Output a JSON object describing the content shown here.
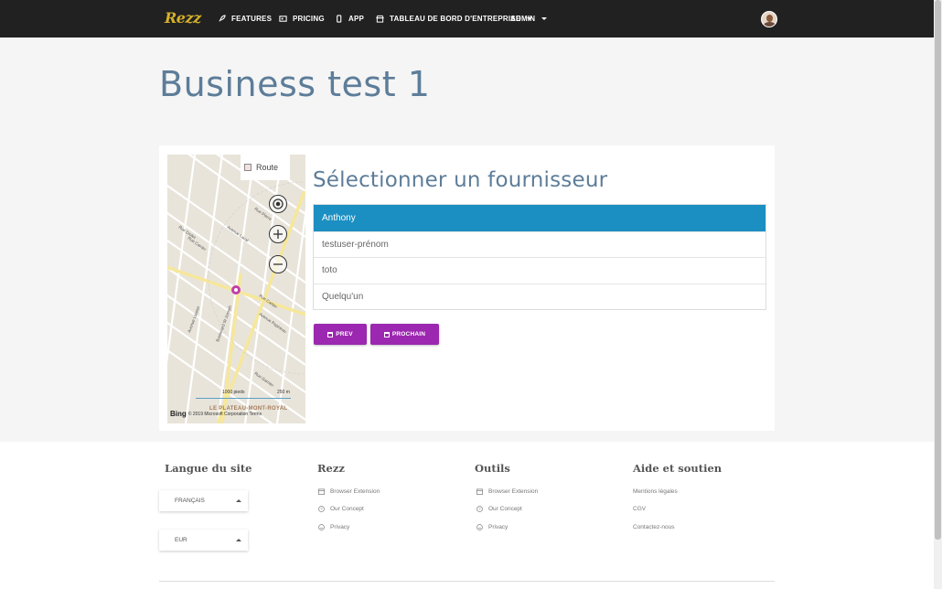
{
  "nav": {
    "logo": "Rezz",
    "items": [
      {
        "label": "FEATURES",
        "icon": "rocket-icon"
      },
      {
        "label": "PRICING",
        "icon": "tag-icon"
      },
      {
        "label": "APP",
        "icon": "mobile-icon"
      },
      {
        "label": "TABLEAU DE BORD D'ENTREPRISE",
        "icon": "store-icon"
      },
      {
        "label": "ADMIN",
        "icon": ""
      }
    ]
  },
  "page": {
    "title": "Business test 1"
  },
  "map": {
    "route_label": "Route",
    "scale_feet": "1000 pieds",
    "scale_meters": "250 m",
    "district": "LE PLATEAU-MONT-ROYAL",
    "attribution": "© 2019 Microsoft Corporation  Terms",
    "bing": "Bing"
  },
  "supplier": {
    "title": "Sélectionner un fournisseur",
    "items": [
      "Anthony",
      "testuser-prénom",
      "toto",
      "Quelqu'un"
    ],
    "active_index": 0,
    "prev_label": "PREV",
    "next_label": "PROCHAIN"
  },
  "footer": {
    "language": {
      "heading": "Langue du site",
      "language_value": "FRANÇAIS",
      "currency_value": "EUR"
    },
    "rezz": {
      "heading": "Rezz",
      "links": [
        "Browser Extension",
        "Our Concept",
        "Privacy"
      ]
    },
    "outils": {
      "heading": "Outils",
      "links": [
        "Browser Extension",
        "Our Concept",
        "Privacy"
      ]
    },
    "aide": {
      "heading": "Aide et soutien",
      "links": [
        "Mentions légales",
        "CGV",
        "Contactez-nous"
      ]
    }
  },
  "colors": {
    "navbar": "#212121",
    "accent_purple": "#9c27b0",
    "active_blue": "#1b8fc2",
    "title_blue": "#5d7d99"
  }
}
